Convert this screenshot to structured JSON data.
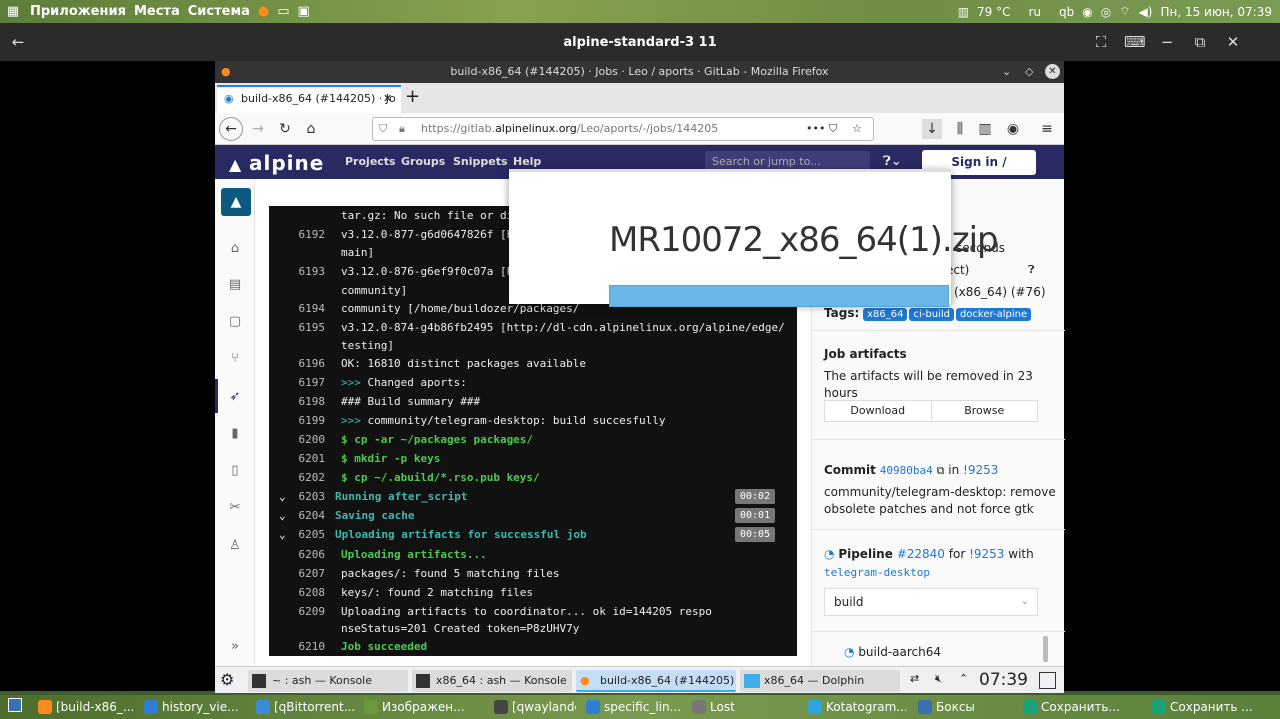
{
  "top_panel": {
    "menus": [
      "Приложения",
      "Места",
      "Система"
    ],
    "temperature": "79 °C",
    "lang": "ru",
    "qb": "qb",
    "datetime": "Пн, 15 июн, 07:39"
  },
  "remote_window": {
    "title": "alpine-standard-3 11"
  },
  "firefox": {
    "title": "build-x86_64 (#144205) · Jobs · Leo / aports · GitLab - Mozilla Firefox",
    "tab_label": "build-x86_64 (#144205) · Jo",
    "url_prefix": "https://gitlab.",
    "url_host": "alpinelinux.org",
    "url_path": "/Leo/aports/-/jobs/144205"
  },
  "gitlab": {
    "logo": "alpine",
    "nav": [
      "Projects",
      "Groups",
      "Snippets",
      "Help"
    ],
    "search_placeholder": "Search or jump to...",
    "signin": "Sign in / Register"
  },
  "log_lines": [
    {
      "num": "",
      "text": "tar.gz: No such file or dire",
      "cls": ""
    },
    {
      "num": "6192",
      "text": "v3.12.0-877-g6d0647826f [h",
      "cls": ""
    },
    {
      "num": "",
      "text": "main]",
      "cls": ""
    },
    {
      "num": "6193",
      "text": "v3.12.0-876-g6ef9f0c07a [h",
      "cls": ""
    },
    {
      "num": "",
      "text": "community]",
      "cls": ""
    },
    {
      "num": "6194",
      "text": "community  [/home/buildozer/packages/",
      "cls": ""
    },
    {
      "num": "6195",
      "text": "v3.12.0-874-g4b86fb2495 [http://dl-cdn.alpinelinux.org/alpine/edge/",
      "cls": ""
    },
    {
      "num": "",
      "text": "testing]",
      "cls": ""
    },
    {
      "num": "6196",
      "text": "OK: 16810 distinct packages available",
      "cls": ""
    },
    {
      "num": "6197",
      "prefix": ">>> ",
      "text": "Changed aports:",
      "cls": ""
    },
    {
      "num": "6198",
      "text": "### Build summary ###",
      "cls": ""
    },
    {
      "num": "6199",
      "prefix": ">>> ",
      "text": "community/telegram-desktop: build succesfully",
      "cls": ""
    },
    {
      "num": "6200",
      "text": "$ cp -ar ~/packages packages/",
      "cls": "g"
    },
    {
      "num": "6201",
      "text": "$ mkdir -p keys",
      "cls": "g"
    },
    {
      "num": "6202",
      "text": "$ cp ~/.abuild/*.rso.pub keys/",
      "cls": "g"
    },
    {
      "num": "6203",
      "text": "Running after_script",
      "cls": "c",
      "section": true,
      "badge": "00:02"
    },
    {
      "num": "6204",
      "text": "Saving cache",
      "cls": "c",
      "section": true,
      "badge": "00:01"
    },
    {
      "num": "6205",
      "text": "Uploading artifacts for successful job",
      "cls": "c",
      "section": true,
      "badge": "00:05"
    },
    {
      "num": "6206",
      "text": "Uploading artifacts...",
      "cls": "g"
    },
    {
      "num": "6207",
      "text": "packages/: found 5 matching files",
      "cls": ""
    },
    {
      "num": "6208",
      "text": "keys/: found 2 matching files",
      "cls": ""
    },
    {
      "num": "6209",
      "text": "Uploading artifacts to coordinator... ok            id=144205 respo",
      "cls": ""
    },
    {
      "num": "",
      "text": "nseStatus=201 Created token=P8zUHV7y",
      "cls": ""
    },
    {
      "num": "6210",
      "text": "Job succeeded",
      "cls": "g"
    }
  ],
  "sidebar": {
    "seconds": "seconds",
    "project_frag": "ect)",
    "runner_frag": "(x86_64) (#76)",
    "tags_label": "Tags:",
    "tags": [
      "x86_64",
      "ci-build",
      "docker-alpine"
    ],
    "artifacts_title": "Job artifacts",
    "artifacts_desc_1": "The artifacts will be removed in 23",
    "artifacts_desc_2": "hours",
    "download": "Download",
    "browse": "Browse",
    "commit_label": "Commit",
    "commit_hash": "40980ba4",
    "commit_in": "in",
    "commit_mr": "!9253",
    "commit_msg_1": "community/telegram-desktop: remove",
    "commit_msg_2": "obsolete patches and not force gtk",
    "pipeline_label": "Pipeline",
    "pipeline_num": "#22840",
    "pipeline_for": "for",
    "pipeline_mr": "!9253",
    "pipeline_with": "with",
    "pipeline_branch": "telegram-desktop",
    "stage_select": "build",
    "job_next": "build-aarch64"
  },
  "popup": {
    "filename": "MR10072_x86_64(1).zip"
  },
  "remote_taskbar": {
    "items": [
      "~ : ash — Konsole",
      "x86_64 : ash — Konsole",
      "build-x86_64 (#144205)",
      "x86_64 — Dolphin"
    ],
    "time": "07:39"
  },
  "bottom_panel": {
    "items": [
      "[build-x86_...",
      "history_vie...",
      "[qBittorrent...",
      "Изображен...",
      "[qwaylandc...",
      "specific_lin...",
      "Lost",
      "Kotatogram...",
      "Боксы",
      "Сохранить...",
      "Сохранить ..."
    ]
  },
  "colors": {
    "gitlab_header": "#2a2a63",
    "accent": "#1f78d1",
    "log_green": "#4ec94e",
    "log_cyan": "#3fb9b0"
  }
}
